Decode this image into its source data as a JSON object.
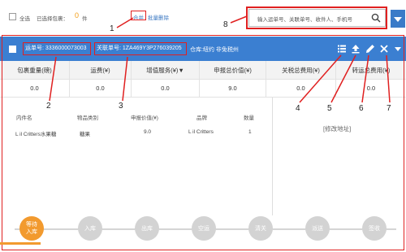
{
  "toolbar": {
    "select_all": "全选",
    "selected_label": "已选择包裹：",
    "selected_count": "0",
    "selected_unit": "件",
    "merge": "合并",
    "batch_delete": "批量删除",
    "search_placeholder": "输入运单号、关联单号、收件人、手机号"
  },
  "package": {
    "waybill": "运单号: 3336000073003",
    "related": "关联单号: 1ZA469Y3P276039205",
    "warehouse": "仓库:纽约 非免税州"
  },
  "fees": {
    "headers": [
      "包裹重量(磅)",
      "运费(¥)",
      "增值服务(¥)▼",
      "申报总价值(¥)",
      "关税总费用(¥)",
      "转运总费用(¥)"
    ],
    "values": [
      "0.0",
      "0.0",
      "0.0",
      "9.0",
      "0.0",
      "0.0"
    ]
  },
  "items": {
    "headers": [
      "内件名",
      "物品类别",
      "申报价值(¥)",
      "品牌",
      "数量"
    ],
    "row": [
      "L il Critters水果糖",
      "糖果",
      "9.0",
      "L il Critters",
      "1"
    ]
  },
  "modify_address": "[修改地址]",
  "steps": [
    "等待\n入库",
    "入库",
    "出库",
    "空运",
    "清关",
    "派送",
    "签收"
  ],
  "annotations": [
    "1",
    "2",
    "3",
    "4",
    "5",
    "6",
    "7",
    "8"
  ],
  "colors": {
    "bar": "#3b7fd1",
    "accent": "#f29a2e",
    "highlight": "#e02020"
  }
}
